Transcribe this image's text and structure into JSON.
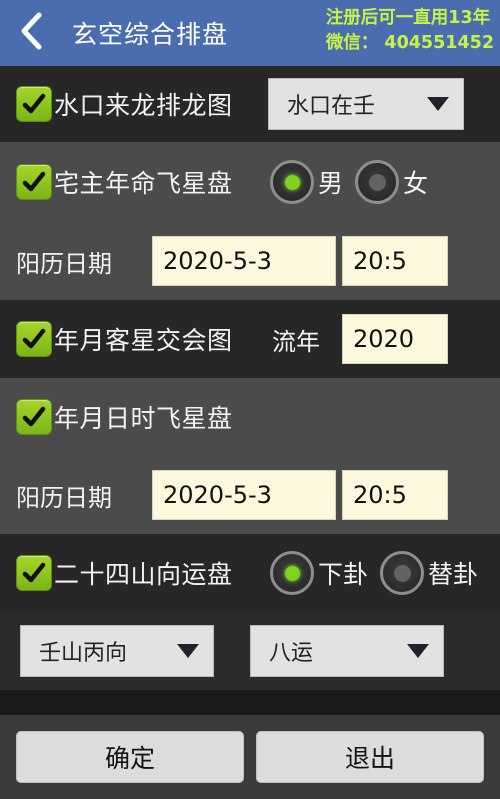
{
  "header": {
    "back_icon": "chevron-left-icon",
    "title": "玄空综合排盘",
    "promo_line1": "注册后可一直用13年",
    "promo_line2": "微信： 404551452",
    "bg_color": "#4a6db0",
    "promo_color": "#c6f24a"
  },
  "rows": {
    "water_mouth": {
      "label": "水口来龙排龙图",
      "checked": true,
      "dropdown_value": "水口在壬"
    },
    "owner_star": {
      "label": "宅主年命飞星盘",
      "checked": true,
      "radio_male": "男",
      "radio_female": "女",
      "selected": "男"
    },
    "solar_date_1": {
      "label": "阳历日期",
      "date_value": "2020-5-3",
      "time_value": "20:5"
    },
    "guest_star": {
      "label": "年月客星交会图",
      "checked": true,
      "year_label": "流年",
      "year_value": "2020"
    },
    "ymdh_star": {
      "label": "年月日时飞星盘",
      "checked": true
    },
    "solar_date_2": {
      "label": "阳历日期",
      "date_value": "2020-5-3",
      "time_value": "20:5"
    },
    "mountain_plate": {
      "label": "二十四山向运盘",
      "checked": true,
      "radio_lower": "下卦",
      "radio_replace": "替卦",
      "selected": "下卦"
    },
    "selectors": {
      "direction_value": "壬山丙向",
      "period_value": "八运"
    }
  },
  "footer": {
    "confirm_label": "确定",
    "exit_label": "退出"
  },
  "theme": {
    "checkbox_green": "#8ec21f",
    "radio_on_green": "#7ed321",
    "input_cream": "#fbf8dd",
    "row_dark": "#272727",
    "row_light": "#4b4b4b"
  }
}
